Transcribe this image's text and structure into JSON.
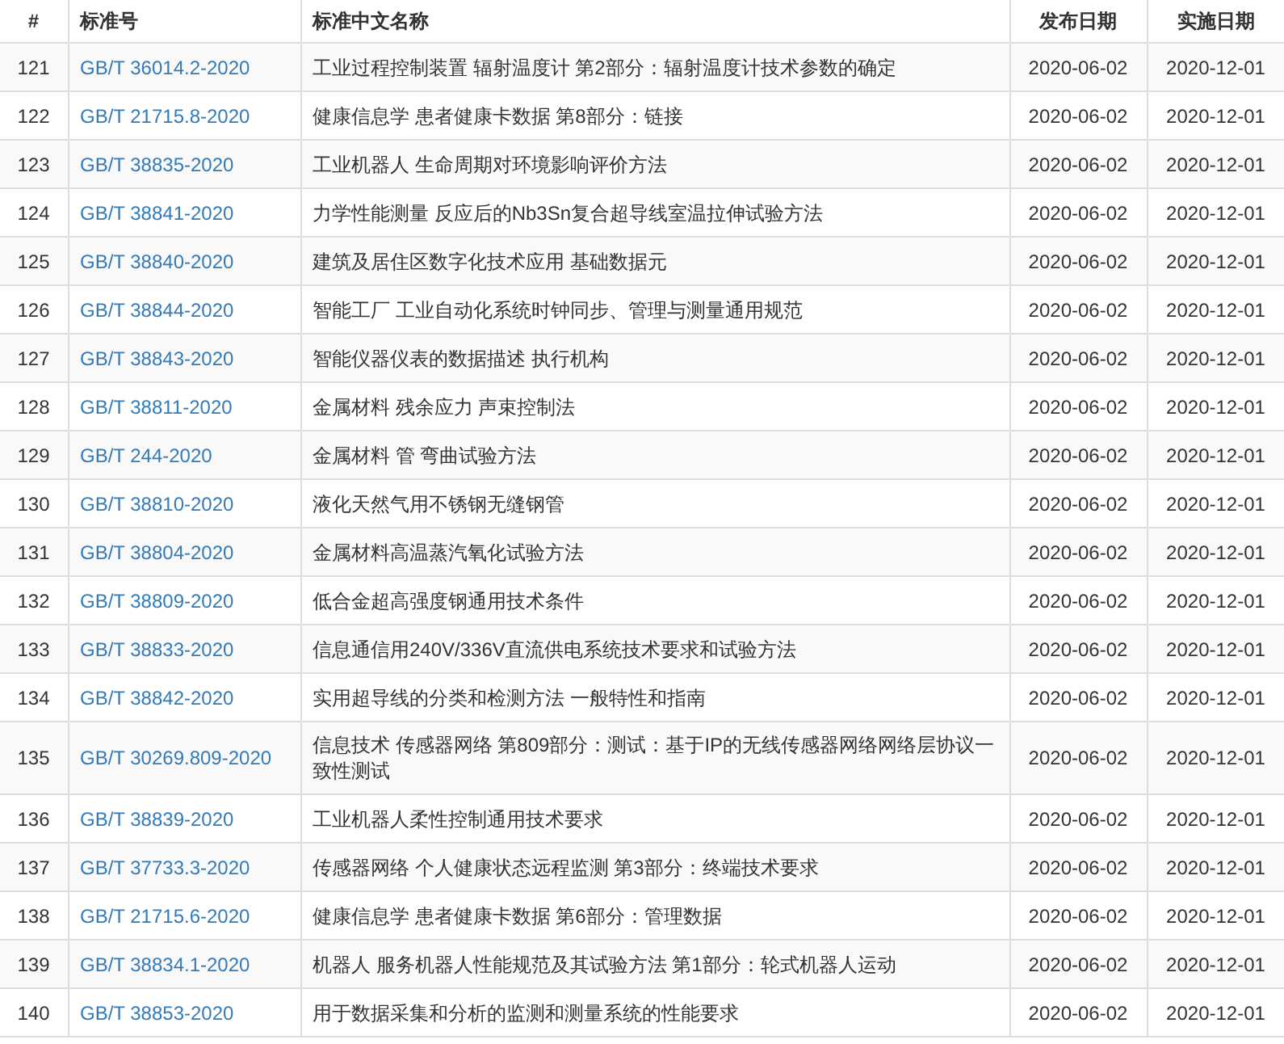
{
  "table": {
    "columns": [
      "#",
      "标准号",
      "标准中文名称",
      "发布日期",
      "实施日期"
    ],
    "rows": [
      {
        "no": "121",
        "code": "GB/T 36014.2-2020",
        "name": "工业过程控制装置 辐射温度计 第2部分：辐射温度计技术参数的确定",
        "published": "2020-06-02",
        "effective": "2020-12-01"
      },
      {
        "no": "122",
        "code": "GB/T 21715.8-2020",
        "name": "健康信息学 患者健康卡数据 第8部分：链接",
        "published": "2020-06-02",
        "effective": "2020-12-01"
      },
      {
        "no": "123",
        "code": "GB/T 38835-2020",
        "name": "工业机器人 生命周期对环境影响评价方法",
        "published": "2020-06-02",
        "effective": "2020-12-01"
      },
      {
        "no": "124",
        "code": "GB/T 38841-2020",
        "name": "力学性能测量 反应后的Nb3Sn复合超导线室温拉伸试验方法",
        "published": "2020-06-02",
        "effective": "2020-12-01"
      },
      {
        "no": "125",
        "code": "GB/T 38840-2020",
        "name": "建筑及居住区数字化技术应用 基础数据元",
        "published": "2020-06-02",
        "effective": "2020-12-01"
      },
      {
        "no": "126",
        "code": "GB/T 38844-2020",
        "name": "智能工厂 工业自动化系统时钟同步、管理与测量通用规范",
        "published": "2020-06-02",
        "effective": "2020-12-01"
      },
      {
        "no": "127",
        "code": "GB/T 38843-2020",
        "name": "智能仪器仪表的数据描述 执行机构",
        "published": "2020-06-02",
        "effective": "2020-12-01"
      },
      {
        "no": "128",
        "code": "GB/T 38811-2020",
        "name": "金属材料 残余应力 声束控制法",
        "published": "2020-06-02",
        "effective": "2020-12-01"
      },
      {
        "no": "129",
        "code": "GB/T 244-2020",
        "name": "金属材料 管 弯曲试验方法",
        "published": "2020-06-02",
        "effective": "2020-12-01"
      },
      {
        "no": "130",
        "code": "GB/T 38810-2020",
        "name": "液化天然气用不锈钢无缝钢管",
        "published": "2020-06-02",
        "effective": "2020-12-01"
      },
      {
        "no": "131",
        "code": "GB/T 38804-2020",
        "name": "金属材料高温蒸汽氧化试验方法",
        "published": "2020-06-02",
        "effective": "2020-12-01"
      },
      {
        "no": "132",
        "code": "GB/T 38809-2020",
        "name": "低合金超高强度钢通用技术条件",
        "published": "2020-06-02",
        "effective": "2020-12-01"
      },
      {
        "no": "133",
        "code": "GB/T 38833-2020",
        "name": "信息通信用240V/336V直流供电系统技术要求和试验方法",
        "published": "2020-06-02",
        "effective": "2020-12-01"
      },
      {
        "no": "134",
        "code": "GB/T 38842-2020",
        "name": "实用超导线的分类和检测方法 一般特性和指南",
        "published": "2020-06-02",
        "effective": "2020-12-01"
      },
      {
        "no": "135",
        "code": "GB/T 30269.809-2020",
        "name": "信息技术 传感器网络 第809部分：测试：基于IP的无线传感器网络网络层协议一致性测试",
        "published": "2020-06-02",
        "effective": "2020-12-01"
      },
      {
        "no": "136",
        "code": "GB/T 38839-2020",
        "name": "工业机器人柔性控制通用技术要求",
        "published": "2020-06-02",
        "effective": "2020-12-01"
      },
      {
        "no": "137",
        "code": "GB/T 37733.3-2020",
        "name": "传感器网络 个人健康状态远程监测 第3部分：终端技术要求",
        "published": "2020-06-02",
        "effective": "2020-12-01"
      },
      {
        "no": "138",
        "code": "GB/T 21715.6-2020",
        "name": "健康信息学 患者健康卡数据 第6部分：管理数据",
        "published": "2020-06-02",
        "effective": "2020-12-01"
      },
      {
        "no": "139",
        "code": "GB/T 38834.1-2020",
        "name": "机器人 服务机器人性能规范及其试验方法 第1部分：轮式机器人运动",
        "published": "2020-06-02",
        "effective": "2020-12-01"
      },
      {
        "no": "140",
        "code": "GB/T 38853-2020",
        "name": "用于数据采集和分析的监测和测量系统的性能要求",
        "published": "2020-06-02",
        "effective": "2020-12-01"
      }
    ]
  }
}
